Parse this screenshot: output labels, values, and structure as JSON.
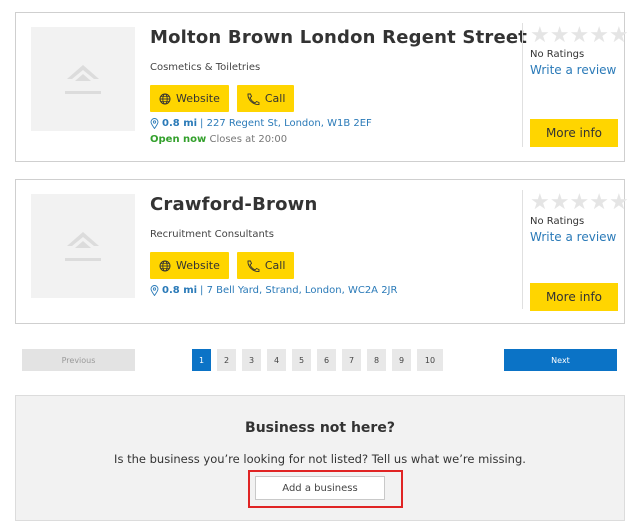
{
  "listings": [
    {
      "name": "Molton Brown London Regent Street",
      "category": "Cosmetics & Toiletries",
      "website_label": "Website",
      "call_label": "Call",
      "distance": "0.8 mi",
      "address": "| 227 Regent St, London, W1B 2EF",
      "open_status": "Open now",
      "closes": "Closes at 20:00",
      "rating_text": "No Ratings",
      "review_link": "Write a review",
      "more_info": "More info"
    },
    {
      "name": "Crawford-Brown",
      "category": "Recruitment Consultants",
      "website_label": "Website",
      "call_label": "Call",
      "distance": "0.8 mi",
      "address": "| 7 Bell Yard, Strand, London, WC2A 2JR",
      "rating_text": "No Ratings",
      "review_link": "Write a review",
      "more_info": "More info"
    }
  ],
  "pagination": {
    "previous": "Previous",
    "next": "Next",
    "pages": [
      "1",
      "2",
      "3",
      "4",
      "5",
      "6",
      "7",
      "8",
      "9",
      "10"
    ],
    "current": "1"
  },
  "not_listed": {
    "title": "Business not here?",
    "text": "Is the business you’re looking for not listed? Tell us what we’re missing.",
    "button": "Add a business"
  },
  "colors": {
    "accent_yellow": "#ffd500",
    "link_blue": "#2a7ab8",
    "primary_blue": "#0b73c6",
    "open_green": "#33a02c",
    "highlight_red": "#e02424"
  }
}
